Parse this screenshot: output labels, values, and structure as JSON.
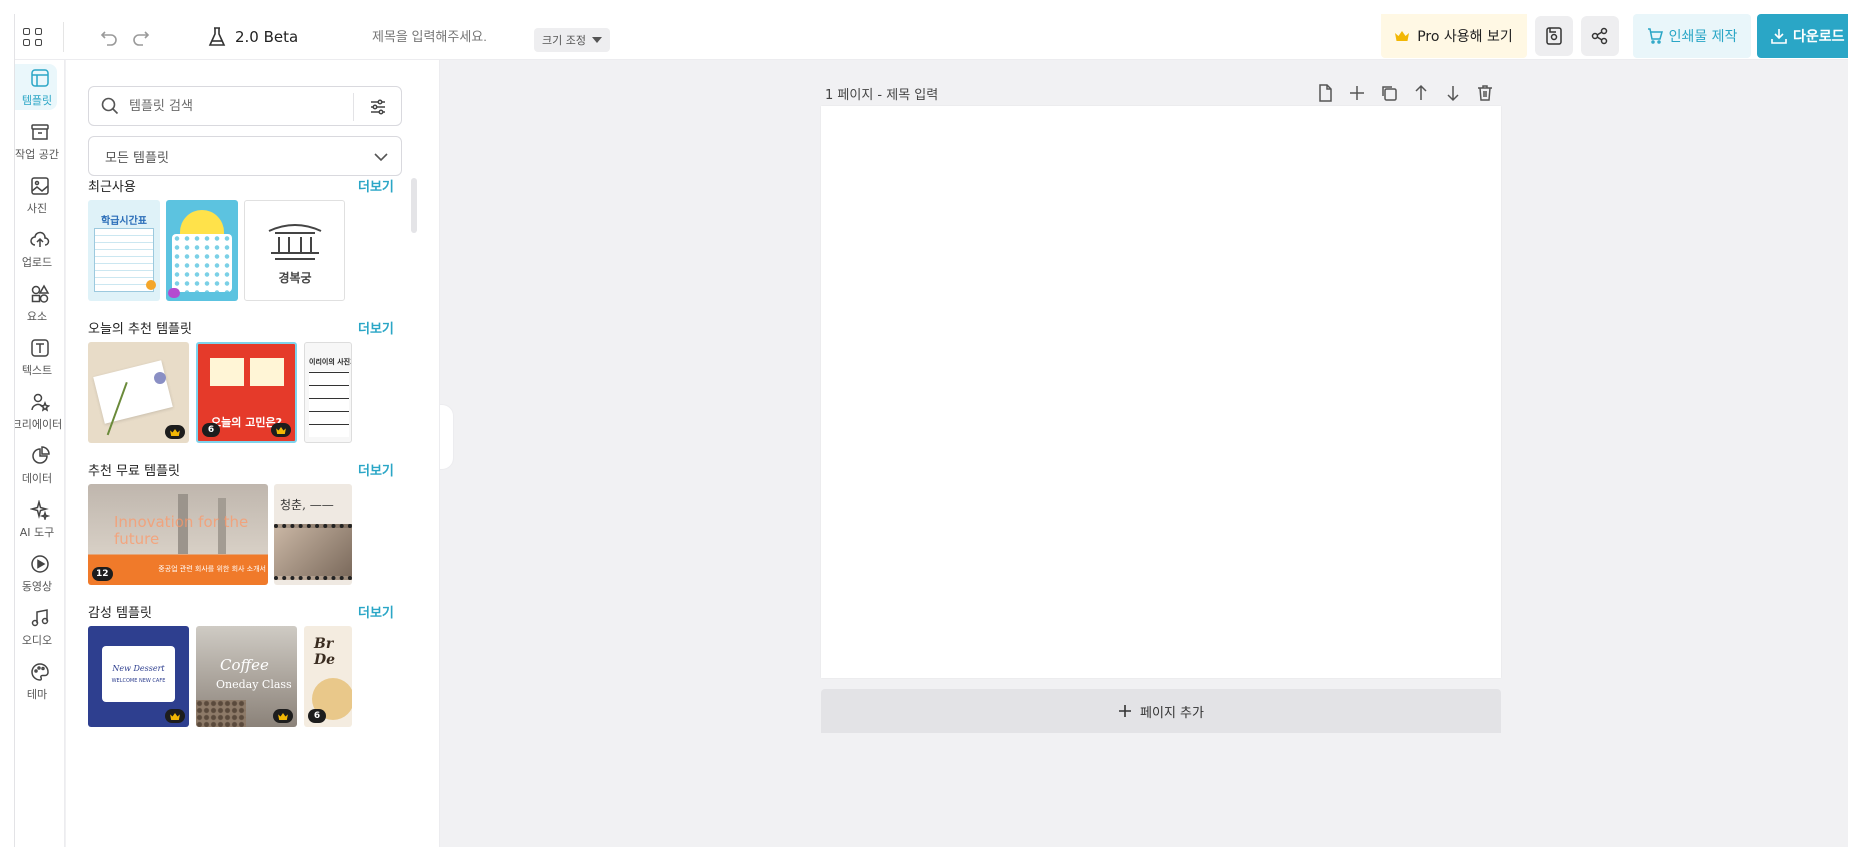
{
  "topbar": {
    "version": "2.0 Beta",
    "title_placeholder": "제목을 입력해주세요.",
    "resize_label": "크기 조정",
    "pro_label": "Pro 사용해 보기",
    "print_label": "인쇄물 제작",
    "download_label": "다운로드"
  },
  "rail": {
    "items": [
      {
        "label": "템플릿",
        "icon": "template-icon"
      },
      {
        "label": "작업 공간",
        "icon": "archive-icon"
      },
      {
        "label": "사진",
        "icon": "image-icon"
      },
      {
        "label": "업로드",
        "icon": "upload-icon"
      },
      {
        "label": "요소",
        "icon": "shapes-icon"
      },
      {
        "label": "텍스트",
        "icon": "text-icon"
      },
      {
        "label": "크리에이터",
        "icon": "creator-icon"
      },
      {
        "label": "데이터",
        "icon": "chart-icon"
      },
      {
        "label": "AI 도구",
        "icon": "sparkle-icon"
      },
      {
        "label": "동영상",
        "icon": "play-icon"
      },
      {
        "label": "오디오",
        "icon": "music-icon"
      },
      {
        "label": "테마",
        "icon": "palette-icon"
      }
    ]
  },
  "panel": {
    "search_placeholder": "템플릿 검색",
    "select_value": "모든 템플릿",
    "more_label": "더보기",
    "sections": [
      {
        "title": "최근사용"
      },
      {
        "title": "오늘의 추천 템플릿"
      },
      {
        "title": "추천 무료 템플릿"
      },
      {
        "title": "감성 템플릿"
      }
    ],
    "thumbs": {
      "recent1_title": "학급시간표",
      "recent3_title": "경복궁",
      "rec2_title": "오늘의 고민은?",
      "rec2_count": "6",
      "rec3_title": "이리이의 사진가",
      "free1_title": "Innovation for the future",
      "free1_sub": "중공업 관련 회사를 위한 회사 소개서",
      "free1_count": "12",
      "free2_title": "청춘, ——",
      "emo1_title": "New Dessert",
      "emo1_sub": "WELCOME NEW CAFE",
      "emo2_title": "Coffee",
      "emo2_sub": "Oneday Class",
      "emo3_title": "Br De",
      "emo3_count": "6"
    }
  },
  "canvas": {
    "page_label": "1 페이지 - 제목 입력",
    "add_page_label": "페이지 추가"
  },
  "colors": {
    "accent": "#2aa6c6",
    "pro_bg": "#fff8e4"
  }
}
